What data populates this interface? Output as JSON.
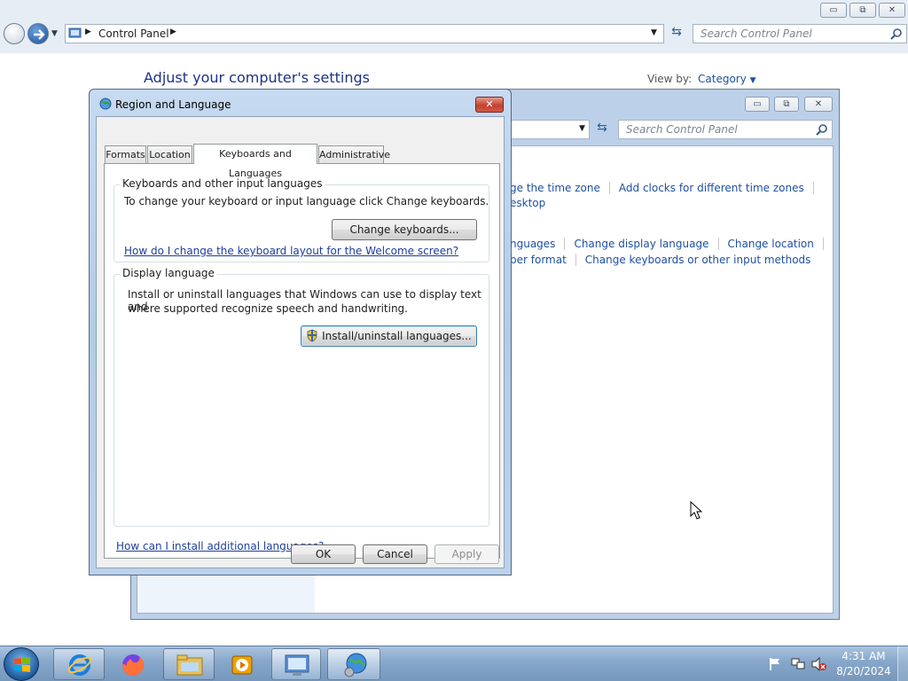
{
  "background_window": {
    "breadcrumb": "Control Panel",
    "search_placeholder": "Search Control Panel",
    "heading": "Adjust your computer's settings",
    "view_by_label": "View by:",
    "view_by_value": "Category",
    "controls": {
      "minimize": "▭",
      "restore": "⧉",
      "close": "✕"
    }
  },
  "second_window": {
    "search_placeholder": "Search Control Panel",
    "controls": {
      "minimize": "▭",
      "restore": "⧉",
      "close": "✕"
    },
    "links_row1": [
      "ge the time zone",
      "Add clocks for different time zones"
    ],
    "links_row2": [
      "esktop"
    ],
    "links_row3": [
      "nguages",
      "Change display language",
      "Change location"
    ],
    "links_row4": [
      "ber format",
      "Change keyboards or other input methods"
    ]
  },
  "dialog": {
    "title": "Region and Language",
    "close": "✕",
    "tabs": [
      "Formats",
      "Location",
      "Keyboards and Languages",
      "Administrative"
    ],
    "active_tab": "Keyboards and Languages",
    "keyboards_group": {
      "label": "Keyboards and other input languages",
      "description": "To change your keyboard or input language click Change keyboards.",
      "button": "Change keyboards...",
      "link": "How do I change the keyboard layout for the Welcome screen?"
    },
    "display_group": {
      "label": "Display language",
      "description_line1": "Install or uninstall languages that Windows can use to display text and",
      "description_line2": "where supported recognize speech and handwriting.",
      "button": "Install/uninstall languages..."
    },
    "bottom_link": "How can I install additional languages?",
    "ok": "OK",
    "cancel": "Cancel",
    "apply": "Apply"
  },
  "taskbar": {
    "items": [
      "start-orb",
      "internet-explorer-icon",
      "firefox-icon",
      "file-explorer-icon",
      "media-player-icon",
      "control-panel-icon",
      "region-language-globe-icon"
    ],
    "time": "4:31 AM",
    "date": "8/20/2024"
  }
}
